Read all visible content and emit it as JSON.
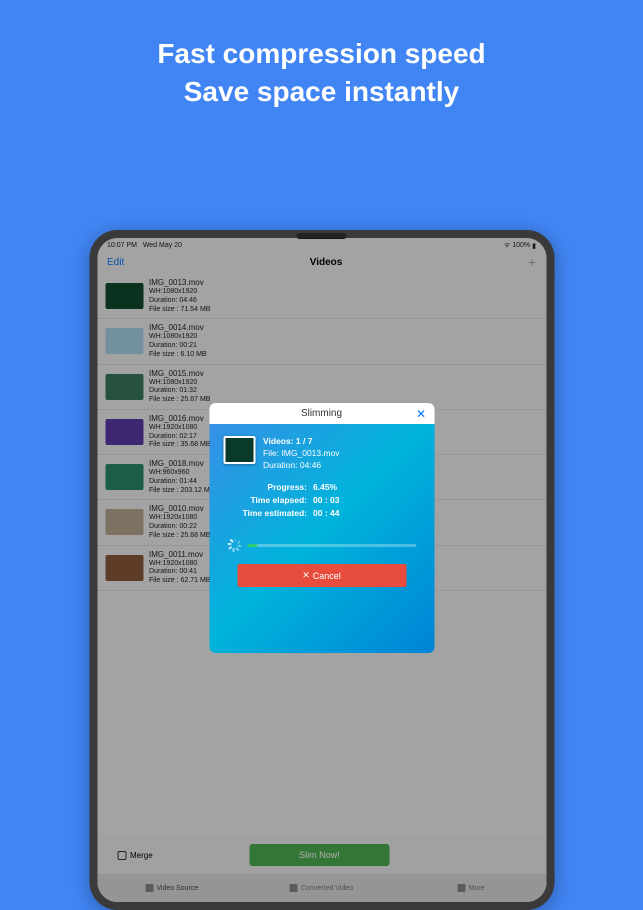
{
  "headline": {
    "line1": "Fast compression speed",
    "line2": "Save space instantly"
  },
  "status": {
    "time": "10:07 PM",
    "date": "Wed May 20",
    "battery": "100%"
  },
  "nav": {
    "edit": "Edit",
    "title": "Videos",
    "plus": "+"
  },
  "videos": [
    {
      "name": "IMG_0013.mov",
      "wh": "WH:1080x1920",
      "dur": "Duration: 04:46",
      "size": "File size : 71.54 MB",
      "color": "#0f4a2f"
    },
    {
      "name": "IMG_0014.mov",
      "wh": "WH:1080x1920",
      "dur": "Duration: 00:21",
      "size": "File size : 6.10 MB",
      "color": "#a8d5e8"
    },
    {
      "name": "IMG_0015.mov",
      "wh": "WH:1080x1920",
      "dur": "Duration: 01:32",
      "size": "File size : 25.67 MB",
      "color": "#3a7a5a"
    },
    {
      "name": "IMG_0016.mov",
      "wh": "WH:1920x1080",
      "dur": "Duration: 02:17",
      "size": "File size : 35.68 MB",
      "color": "#5a3aa8"
    },
    {
      "name": "IMG_0018.mov",
      "wh": "WH:960x960",
      "dur": "Duration: 01:44",
      "size": "File size : 203.12 MB",
      "color": "#2a8a6a"
    },
    {
      "name": "IMG_0010.mov",
      "wh": "WH:1920x1080",
      "dur": "Duration: 00:22",
      "size": "File size : 25.68 MB",
      "color": "#b8a890"
    },
    {
      "name": "IMG_0011.mov",
      "wh": "WH:1920x1080",
      "dur": "Duration: 00:41",
      "size": "File size : 62.71 MB",
      "color": "#8a5a3a"
    }
  ],
  "merge_label": "Merge",
  "slim_label": "Slim Now!",
  "tabs": [
    {
      "label": "Video Source",
      "active": true
    },
    {
      "label": "Converted Video",
      "active": false
    },
    {
      "label": "More",
      "active": false
    }
  ],
  "dialog": {
    "title": "Slimming",
    "videos_label": "Videos:",
    "videos_val": "1 / 7",
    "file_label": "File:",
    "file_val": "IMG_0013.mov",
    "dur_label": "Duration:",
    "dur_val": "04:46",
    "progress_label": "Progress:",
    "progress_val": "6.45%",
    "elapsed_label": "Time elapsed:",
    "elapsed_val": "00 : 03",
    "est_label": "Time estimated:",
    "est_val": "00 : 44",
    "cancel": "Cancel"
  }
}
